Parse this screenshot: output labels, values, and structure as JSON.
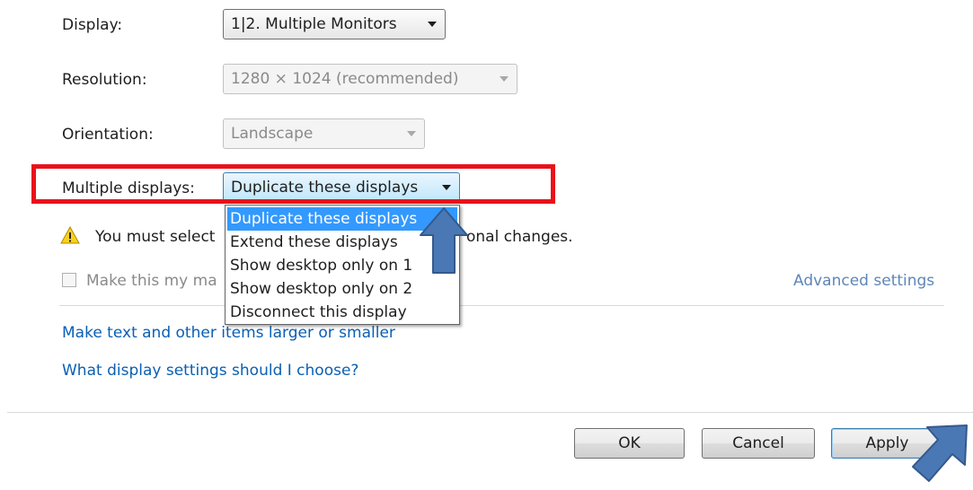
{
  "fields": {
    "display": {
      "label": "Display:",
      "value": "1|2. Multiple Monitors"
    },
    "resolution": {
      "label": "Resolution:",
      "value": "1280 × 1024 (recommended)"
    },
    "orientation": {
      "label": "Orientation:",
      "value": "Landscape"
    },
    "multiple_displays": {
      "label": "Multiple displays:",
      "value": "Duplicate these displays"
    }
  },
  "dropdown": {
    "options": [
      "Duplicate these displays",
      "Extend these displays",
      "Show desktop only on 1",
      "Show desktop only on 2",
      "Disconnect this display"
    ],
    "selected_index": 0
  },
  "warning": {
    "text_left": "You must select",
    "text_right": "onal changes."
  },
  "checkbox": {
    "label": "Make this my ma"
  },
  "links": {
    "advanced": "Advanced settings",
    "text_size": "Make text and other items larger or smaller",
    "choose": "What display settings should I choose?"
  },
  "buttons": {
    "ok": "OK",
    "cancel": "Cancel",
    "apply": "Apply"
  },
  "colors": {
    "highlight_border": "#e8121b",
    "annotation_arrow": "#4a78b5",
    "link": "#0a5fb4",
    "selection": "#3399ff"
  },
  "icons": {
    "warning": "warning-icon",
    "annotation": "arrow-icon"
  }
}
